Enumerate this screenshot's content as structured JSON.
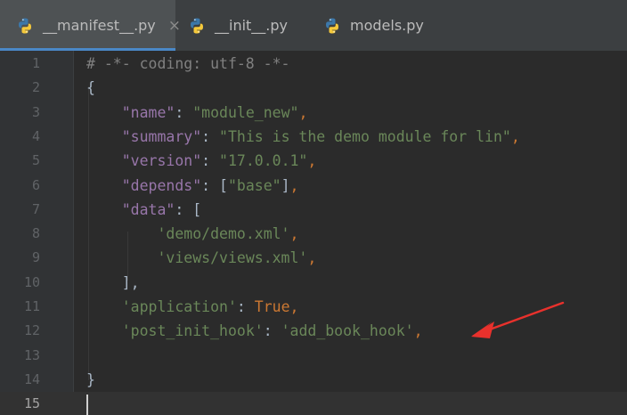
{
  "tabs": [
    {
      "label": "__manifest__.py",
      "close": "×",
      "active": true
    },
    {
      "label": "__init__.py",
      "active": false
    },
    {
      "label": "models.py",
      "active": false
    }
  ],
  "editor": {
    "line_numbers": [
      "1",
      "2",
      "3",
      "4",
      "5",
      "6",
      "7",
      "8",
      "9",
      "10",
      "11",
      "12",
      "13",
      "14",
      "15"
    ],
    "current_line": "15",
    "lines": [
      [
        {
          "t": "# -*- coding: utf-8 -*-",
          "c": "cm"
        }
      ],
      [
        {
          "t": "{",
          "c": "br"
        }
      ],
      [
        {
          "t": "    "
        },
        {
          "t": "\"name\"",
          "c": "key"
        },
        {
          "t": ": "
        },
        {
          "t": "\"module_new\"",
          "c": "str"
        },
        {
          "t": ",",
          "c": "op"
        }
      ],
      [
        {
          "t": "    "
        },
        {
          "t": "\"summary\"",
          "c": "key"
        },
        {
          "t": ": "
        },
        {
          "t": "\"This is the demo module for lin\"",
          "c": "str"
        },
        {
          "t": ",",
          "c": "op"
        }
      ],
      [
        {
          "t": "    "
        },
        {
          "t": "\"version\"",
          "c": "key"
        },
        {
          "t": ": "
        },
        {
          "t": "\"17.0.0.1\"",
          "c": "str"
        },
        {
          "t": ",",
          "c": "op"
        }
      ],
      [
        {
          "t": "    "
        },
        {
          "t": "\"depends\"",
          "c": "key"
        },
        {
          "t": ": ["
        },
        {
          "t": "\"base\"",
          "c": "str"
        },
        {
          "t": "]"
        },
        {
          "t": ",",
          "c": "op"
        }
      ],
      [
        {
          "t": "    "
        },
        {
          "t": "\"data\"",
          "c": "key"
        },
        {
          "t": ": ["
        }
      ],
      [
        {
          "t": "        "
        },
        {
          "t": "'demo/demo.xml'",
          "c": "str"
        },
        {
          "t": ",",
          "c": "op"
        }
      ],
      [
        {
          "t": "        "
        },
        {
          "t": "'views/views.xml'",
          "c": "str"
        },
        {
          "t": ",",
          "c": "op"
        }
      ],
      [
        {
          "t": "    ],"
        }
      ],
      [
        {
          "t": "    "
        },
        {
          "t": "'application'",
          "c": "str"
        },
        {
          "t": ": "
        },
        {
          "t": "True",
          "c": "kw"
        },
        {
          "t": ",",
          "c": "op"
        }
      ],
      [
        {
          "t": "    "
        },
        {
          "t": "'post_init_hook'",
          "c": "str"
        },
        {
          "t": ": "
        },
        {
          "t": "'add_book_hook'",
          "c": "str"
        },
        {
          "t": ",",
          "c": "op"
        }
      ],
      [
        {
          "t": ""
        }
      ],
      [
        {
          "t": "}",
          "c": "br"
        }
      ],
      [
        {
          "t": ""
        }
      ]
    ]
  },
  "colors": {
    "accent": "#4a88c7",
    "annotation_arrow": "#e8312c",
    "string": "#6a8759",
    "key": "#9876aa",
    "keyword": "#cc7832",
    "comment": "#808080"
  },
  "icons": {
    "tab_file": "python-file-icon",
    "annotation": "red-arrow-annotation"
  }
}
